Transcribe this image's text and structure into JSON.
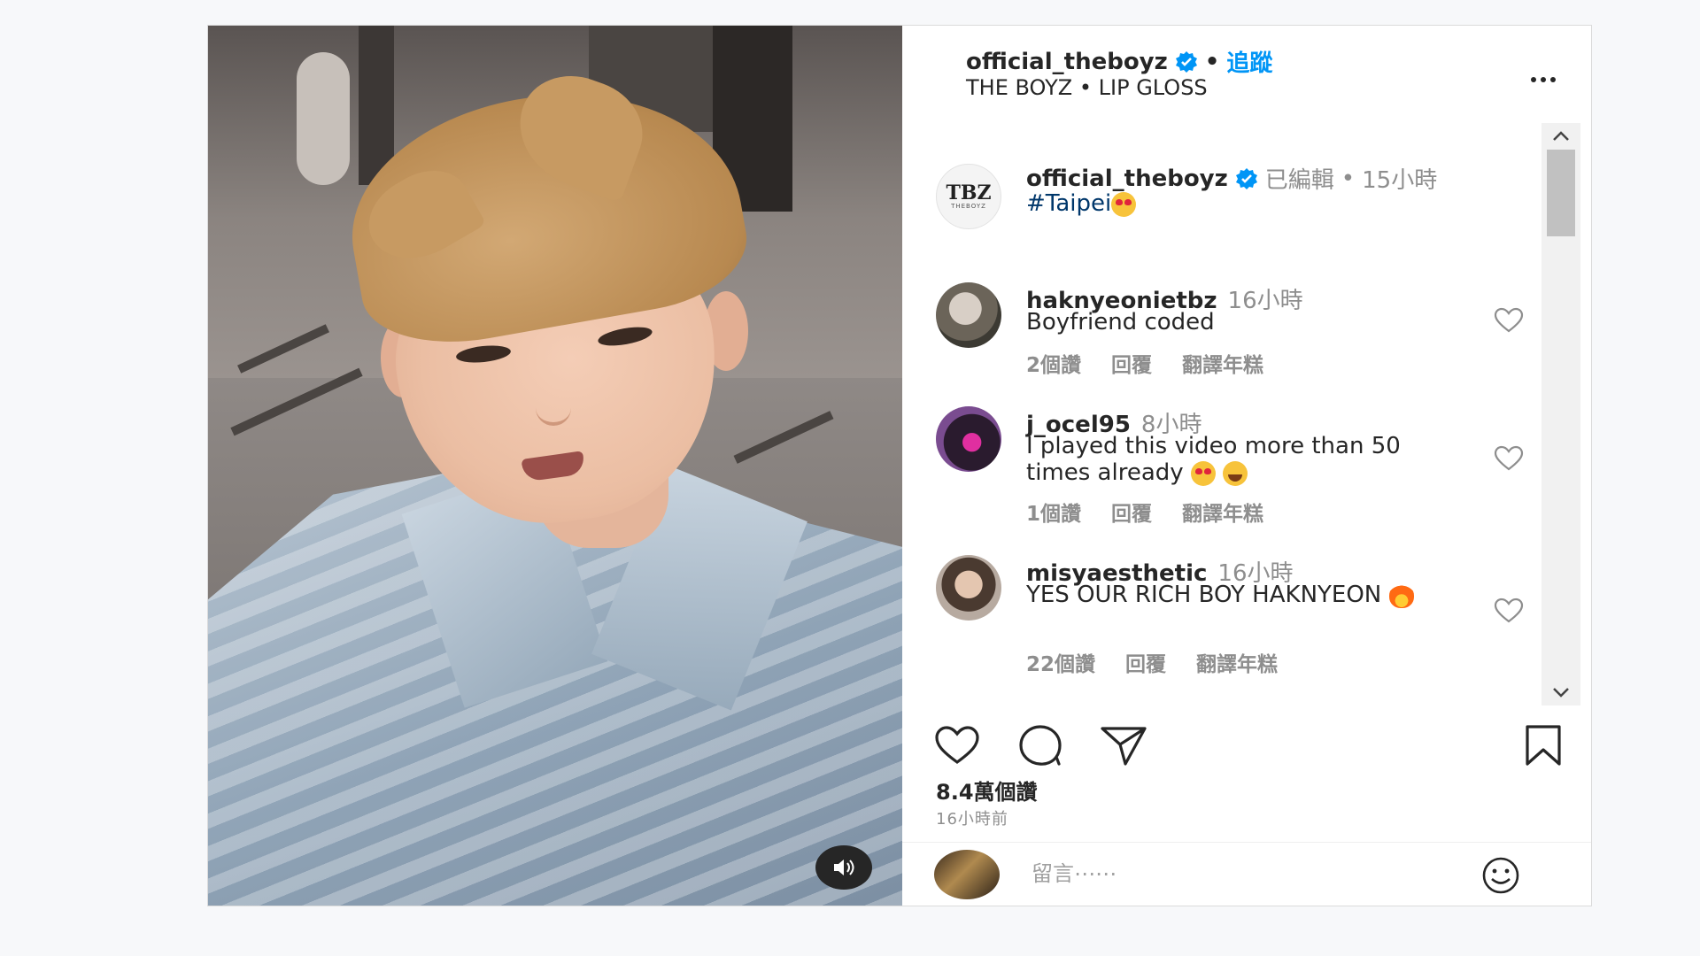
{
  "post": {
    "header": {
      "username": "official_theboyz",
      "separator": "•",
      "follow_label": "追蹤",
      "subtitle": "THE BOYZ • LIP GLOSS"
    },
    "caption": {
      "avatar_text": "TBZ",
      "avatar_subtext": "THEBOYZ",
      "username": "official_theboyz",
      "edited": "已編輯",
      "separator": "•",
      "time": "15小時",
      "text": "#Taipei"
    },
    "comments": [
      {
        "username": "haknyeonietbz",
        "time": "16小時",
        "text": "Boyfriend coded",
        "likes": "2個讚",
        "reply": "回覆",
        "translate": "翻譯年糕"
      },
      {
        "username": "j_ocel95",
        "time": "8小時",
        "text": "I played this video more than 50 times already",
        "likes": "1個讚",
        "reply": "回覆",
        "translate": "翻譯年糕"
      },
      {
        "username": "misyaesthetic",
        "time": "16小時",
        "text": "YES OUR RICH BOY HAKNYEON",
        "likes": "22個讚",
        "reply": "回覆",
        "translate": "翻譯年糕"
      }
    ],
    "likes_count": "8.4萬個讚",
    "posted_ago": "16小時前",
    "comment_input": {
      "placeholder": "留言⋯⋯"
    }
  },
  "icons": {
    "verified": "verified-badge-icon",
    "more": "more-options-icon",
    "like": "heart-icon",
    "comment": "comment-icon",
    "share": "share-icon",
    "save": "bookmark-icon",
    "sound": "speaker-icon",
    "emoji": "smiley-icon"
  },
  "colors": {
    "link": "#0095f6",
    "hashtag": "#00376b",
    "muted": "#8e8e8e"
  }
}
